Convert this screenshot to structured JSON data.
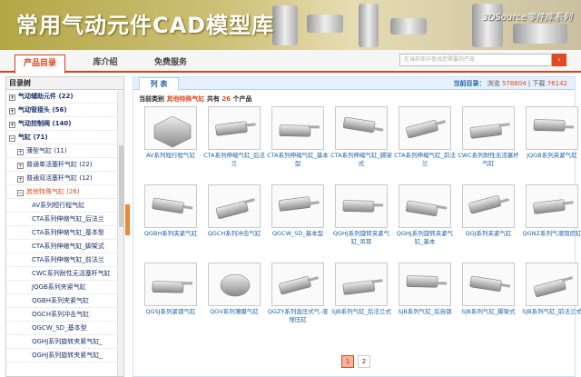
{
  "banner": {
    "title": "常用气动元件CAD模型库",
    "brand": "3DSource零件库系列"
  },
  "nav": {
    "tabs": [
      {
        "label": "产品目录",
        "active": true
      },
      {
        "label": "库介绍",
        "active": false
      },
      {
        "label": "免费服务",
        "active": false
      }
    ],
    "search_placeholder": "在当前库中查找您需要的产品"
  },
  "sidebar": {
    "title": "目录树",
    "categories": [
      {
        "label": "气动辅助元件",
        "count": "(22)",
        "toggle": "+"
      },
      {
        "label": "气动管接头",
        "count": "(56)",
        "toggle": "+"
      },
      {
        "label": "气动控制阀",
        "count": "(140)",
        "toggle": "+"
      },
      {
        "label": "气缸",
        "count": "(71)",
        "toggle": "−"
      }
    ],
    "subcategories": [
      {
        "label": "薄型气缸",
        "count": "(11)",
        "toggle": "+"
      },
      {
        "label": "普通单活塞杆气缸",
        "count": "(22)",
        "toggle": "+"
      },
      {
        "label": "普通双活塞杆气缸",
        "count": "(12)",
        "toggle": "+"
      },
      {
        "label": "其他特殊气缸",
        "count": "(26)",
        "toggle": "−"
      }
    ],
    "items": [
      "AV系列短行程气缸",
      "CTA系列伸缩气缸_后法兰",
      "CTA系列伸缩气缸_基本型",
      "CTA系列伸缩气缸_脚架式",
      "CTA系列伸缩气缸_前法兰",
      "CWC系列耐性无活塞杆气缸",
      "JQGB系列夹紧气缸",
      "QGBH系列夹紧气缸",
      "QGCH系列冲击气缸",
      "QGCW_SD_基本型",
      "QGHJ系列旋转夹紧气缸_",
      "QGHJ系列旋转夹紧气缸_"
    ]
  },
  "main": {
    "tab_label": "列 表",
    "current_label": "当前目录：",
    "browse_label": "浏览",
    "browse_count": "578804",
    "download_label": "下载",
    "download_count": "76142",
    "summary_prefix": "当前类别",
    "summary_category": "其他特殊气缸",
    "summary_mid": "共有",
    "summary_count": "26",
    "summary_suffix": "个产品",
    "products": [
      "AV系列短行程气缸",
      "CTA系列伸缩气缸_后法兰",
      "CTA系列伸缩气缸_基本型",
      "CTA系列伸缩气缸_脚架式",
      "CTA系列伸缩气缸_前法兰",
      "CWC系列耐性无活塞杆气缸",
      "JQGB系列夹紧气缸",
      "QGBH系列夹紧气缸",
      "QGCH系列冲击气缸",
      "QGCW_SD_基本型",
      "QGHJ系列旋转夹紧气缸_吊耳",
      "QGHJ系列旋转夹紧气缸_基本",
      "QGJ系列夹紧气缸",
      "QGNZ系列气液阻尼缸",
      "QGSJ系列紧锁气缸",
      "QGV系列薄膜气缸",
      "QGZY系列直压式气-液增压缸",
      "SJB系列气缸_后法兰式",
      "SJB系列气缸_后自锁",
      "SJB系列气缸_脚架式",
      "SJB系列气缸_前法兰式"
    ],
    "pages": [
      "1",
      "2"
    ],
    "current_page": "1"
  },
  "colors": {
    "accent": "#e04a1e",
    "link": "#1a5fa8",
    "tree_text": "#1a2f6b"
  }
}
